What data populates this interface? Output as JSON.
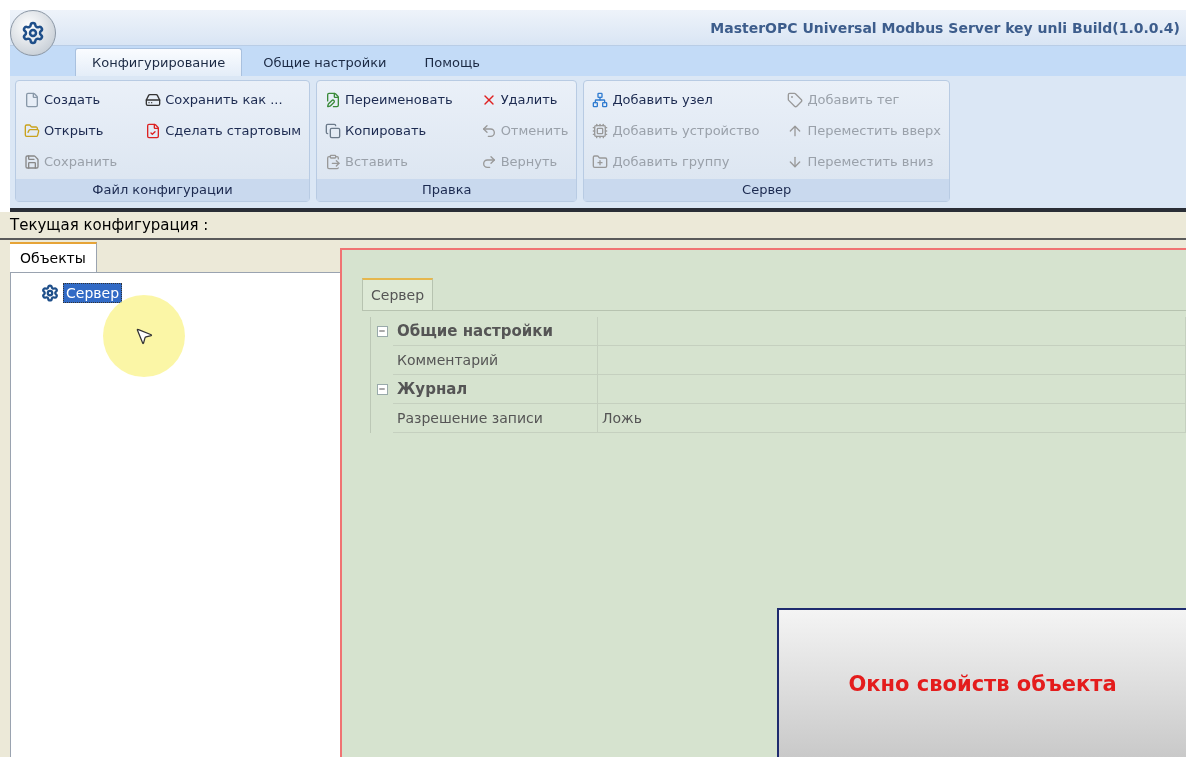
{
  "window": {
    "title": "MasterOPC Universal Modbus Server key unli Build(1.0.0.4)"
  },
  "tabs": [
    {
      "label": "Конфигурирование",
      "selected": true
    },
    {
      "label": "Общие настройки",
      "selected": false
    },
    {
      "label": "Помощь",
      "selected": false
    }
  ],
  "ribbon": {
    "groups": [
      {
        "title": "Файл конфигурации",
        "columns": [
          [
            {
              "label": "Создать",
              "kind": "new",
              "disabled": false
            },
            {
              "label": "Открыть",
              "kind": "open",
              "disabled": false
            },
            {
              "label": "Сохранить",
              "kind": "save",
              "disabled": true
            }
          ],
          [
            {
              "label": "Сохранить как ...",
              "kind": "saveas",
              "disabled": false
            },
            {
              "label": "Сделать стартовым",
              "kind": "start",
              "disabled": false
            }
          ]
        ]
      },
      {
        "title": "Правка",
        "columns": [
          [
            {
              "label": "Переименовать",
              "kind": "rename",
              "disabled": false
            },
            {
              "label": "Копировать",
              "kind": "copy",
              "disabled": false
            },
            {
              "label": "Вставить",
              "kind": "paste",
              "disabled": true
            }
          ],
          [
            {
              "label": "Удалить",
              "kind": "delete",
              "disabled": false
            },
            {
              "label": "Отменить",
              "kind": "undo",
              "disabled": true
            },
            {
              "label": "Вернуть",
              "kind": "redo",
              "disabled": true
            }
          ]
        ]
      },
      {
        "title": "Сервер",
        "columns": [
          [
            {
              "label": "Добавить узел",
              "kind": "node",
              "disabled": false
            },
            {
              "label": "Добавить устройство",
              "kind": "device",
              "disabled": true
            },
            {
              "label": "Добавить группу",
              "kind": "group",
              "disabled": true
            }
          ],
          [
            {
              "label": "Добавить тег",
              "kind": "tag",
              "disabled": true
            },
            {
              "label": "Переместить вверх",
              "kind": "up",
              "disabled": true
            },
            {
              "label": "Переместить вниз",
              "kind": "down",
              "disabled": true
            }
          ]
        ]
      }
    ]
  },
  "current_config": {
    "label": "Текущая конфигурация :"
  },
  "left_tabs": [
    {
      "label": "Объекты",
      "selected": true
    }
  ],
  "tree": [
    {
      "label": "Сервер",
      "selected": true
    }
  ],
  "properties": {
    "tabs": [
      {
        "label": "Сервер",
        "selected": true
      }
    ],
    "sections": [
      {
        "title": "Общие настройки",
        "expanded": true,
        "rows": [
          {
            "name": "Комментарий"
          }
        ]
      },
      {
        "title": "Журнал",
        "expanded": true,
        "rows": [
          {
            "name": "Разрешение записи",
            "value": "Ложь"
          }
        ]
      }
    ]
  },
  "callout": {
    "text": "Окно свойств объекта"
  }
}
